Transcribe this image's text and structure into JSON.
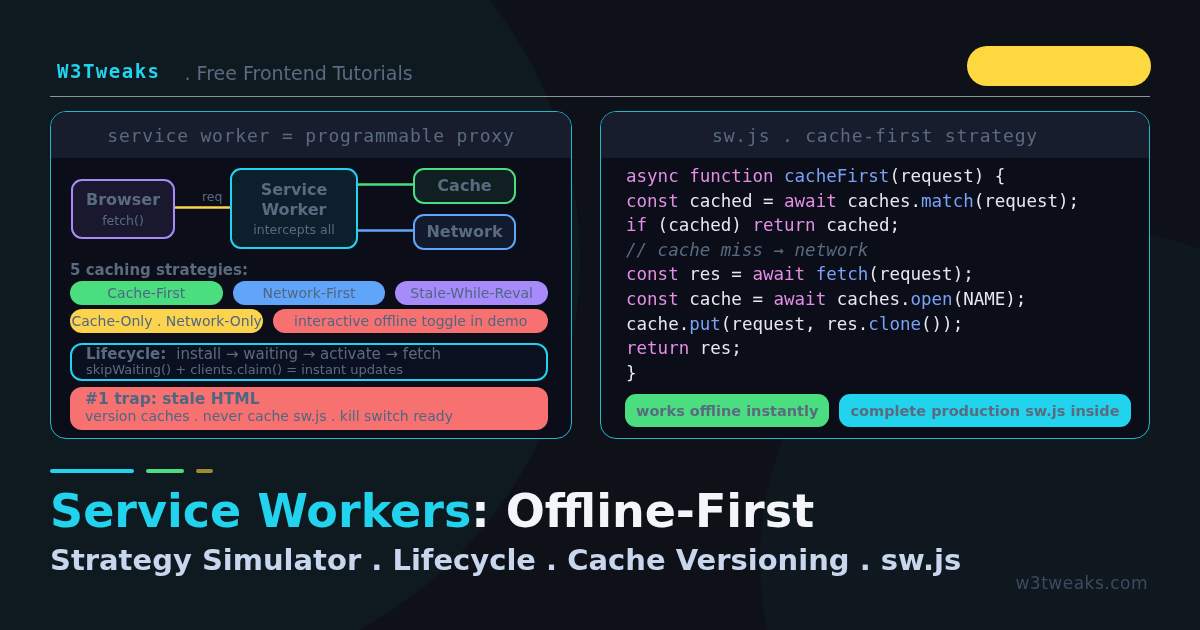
{
  "brand": {
    "name": "W3Tweaks",
    "tagline": ". Free Frontend Tutorials"
  },
  "diagram_panel": {
    "title": "service worker = programmable proxy",
    "nodes": [
      {
        "title": "Browser",
        "subtitle": "fetch()",
        "color": "#a78bfa"
      },
      {
        "title": "Service Worker",
        "subtitle": "intercepts all",
        "color": "#22d3ee"
      },
      {
        "title": "Cache",
        "color": "#4ade80"
      },
      {
        "title": "Network",
        "color": "#60a5fa"
      }
    ],
    "edge_label": "req",
    "strategies_label": "5 caching strategies:",
    "strategies": [
      {
        "label": "Cache-First",
        "color": "#4ade80"
      },
      {
        "label": "Network-First",
        "color": "#60a5fa"
      },
      {
        "label": "Stale-While-Reval",
        "color": "#a78bfa"
      },
      {
        "label": "Cache-Only . Network-Only",
        "color": "#fcd34d"
      },
      {
        "label": "interactive offline toggle in demo",
        "color": "#f87171"
      }
    ],
    "lifecycle": {
      "label": "Lifecycle:",
      "steps": "install → waiting → activate → fetch",
      "note": "skipWaiting() + clients.claim() = instant updates"
    },
    "trap": {
      "title": "#1 trap: stale HTML",
      "note": "version caches . never cache sw.js . kill switch ready"
    }
  },
  "code_panel": {
    "title": "sw.js . cache-first strategy",
    "lines": [
      [
        {
          "kind": "keyword",
          "text": "async function "
        },
        {
          "kind": "fn",
          "text": "cacheFirst"
        },
        {
          "kind": "plain",
          "text": "(request) {"
        }
      ],
      [
        {
          "kind": "keyword",
          "text": "const "
        },
        {
          "kind": "plain",
          "text": "cached = "
        },
        {
          "kind": "keyword",
          "text": "await "
        },
        {
          "kind": "plain",
          "text": "caches."
        },
        {
          "kind": "fn",
          "text": "match"
        },
        {
          "kind": "plain",
          "text": "(request);"
        }
      ],
      [
        {
          "kind": "keyword",
          "text": "if "
        },
        {
          "kind": "plain",
          "text": "(cached) "
        },
        {
          "kind": "keyword",
          "text": "return "
        },
        {
          "kind": "plain",
          "text": "cached;"
        }
      ],
      [
        {
          "kind": "comment",
          "text": "// cache miss → network"
        }
      ],
      [
        {
          "kind": "keyword",
          "text": "const "
        },
        {
          "kind": "plain",
          "text": "res = "
        },
        {
          "kind": "keyword",
          "text": "await "
        },
        {
          "kind": "fn",
          "text": "fetch"
        },
        {
          "kind": "plain",
          "text": "(request);"
        }
      ],
      [
        {
          "kind": "keyword",
          "text": "const "
        },
        {
          "kind": "plain",
          "text": "cache = "
        },
        {
          "kind": "keyword",
          "text": "await "
        },
        {
          "kind": "plain",
          "text": "caches."
        },
        {
          "kind": "fn",
          "text": "open"
        },
        {
          "kind": "plain",
          "text": "(NAME);"
        }
      ],
      [
        {
          "kind": "plain",
          "text": "cache."
        },
        {
          "kind": "fn",
          "text": "put"
        },
        {
          "kind": "plain",
          "text": "(request, res."
        },
        {
          "kind": "fn",
          "text": "clone"
        },
        {
          "kind": "plain",
          "text": "());"
        }
      ],
      [
        {
          "kind": "keyword",
          "text": "return "
        },
        {
          "kind": "plain",
          "text": "res;"
        }
      ],
      [
        {
          "kind": "plain",
          "text": "}"
        }
      ]
    ],
    "tags": [
      {
        "label": "works offline instantly",
        "color": "#4ade80"
      },
      {
        "label": "complete production sw.js inside",
        "color": "#22d3ee"
      }
    ]
  },
  "title": {
    "highlight": "Service Workers",
    "rest": ": Offline-First"
  },
  "subtitle": "Strategy Simulator . Lifecycle . Cache Versioning . sw.js",
  "footer_url": "w3tweaks.com"
}
